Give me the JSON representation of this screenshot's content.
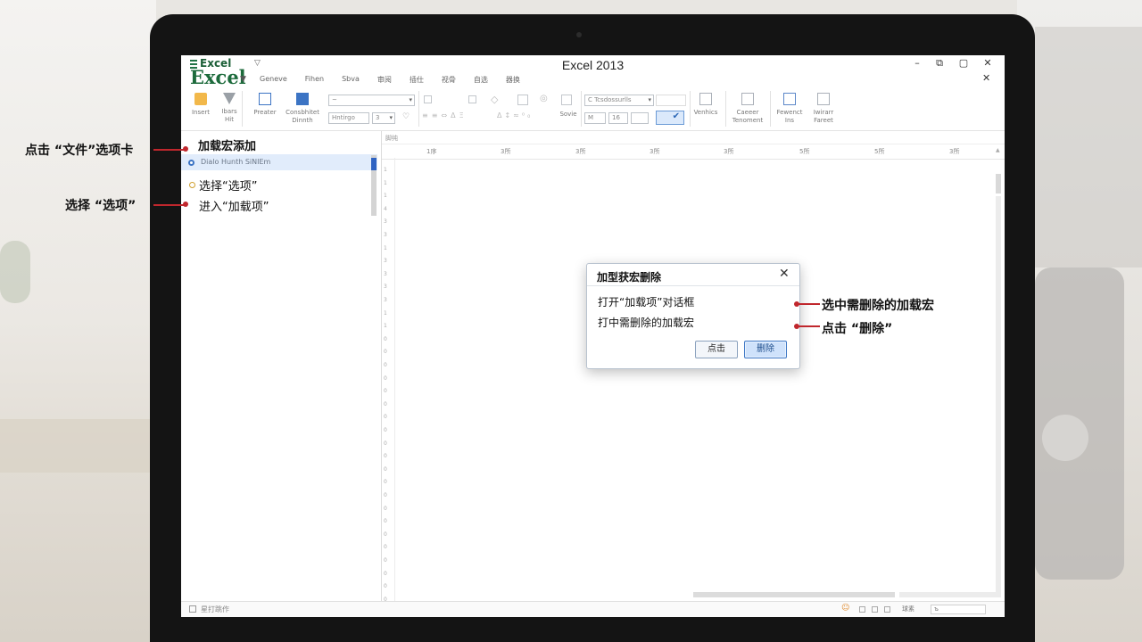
{
  "window": {
    "title": "Excel 2013",
    "logo_small": "Excel",
    "logo_big": "Excel",
    "menu": [
      "Geneve",
      "Fihen",
      "Sbva",
      "审阅",
      "插仕",
      "视骨",
      "自选",
      "器换"
    ],
    "controls": {
      "minimize": "–",
      "restore": "⧉",
      "maximize": "▢",
      "close": "✕",
      "close_doc": "✕"
    }
  },
  "ribbon": {
    "buttons": [
      {
        "label": "Insert"
      },
      {
        "label": "Ibars",
        "label2": "Hit"
      },
      {
        "label": "Preater"
      },
      {
        "label": "Consbhitet",
        "label2": "Dinnth"
      },
      {
        "label": "Venhics"
      },
      {
        "label": "Caeeer",
        "label2": "Tenoment"
      },
      {
        "label": "Fewenct",
        "label2": "Ins"
      },
      {
        "label": "Iwirarr",
        "label2": "Fareet"
      }
    ],
    "font_combo": "~",
    "size_combo": "Hntirgo",
    "size_num": "3",
    "style_combo": "C Tcsdossurlls",
    "num_box1": "M",
    "num_box2": "16",
    "small_groups": [
      "Sovie"
    ]
  },
  "pane": {
    "title": "加载宏添加",
    "selected_item": "Dialo Hunth SiNIEm",
    "items": [
      "选择“选项”",
      "进入“加载项”"
    ]
  },
  "grid": {
    "name_box": "脚纯",
    "columns": [
      "1序",
      "3所",
      "3所",
      "3所",
      "3所",
      "5所",
      "5所",
      "3所"
    ],
    "rows": [
      "1",
      "1",
      "1",
      "4",
      "3",
      "3",
      "1",
      "3",
      "3",
      "3",
      "3",
      "1",
      "1",
      "0",
      "0",
      "0",
      "0",
      "0",
      "0",
      "0",
      "0",
      "0",
      "0",
      "0",
      "0",
      "0",
      "0",
      "0",
      "0",
      "0",
      "0",
      "0",
      "0",
      "0",
      "0"
    ]
  },
  "dialog": {
    "title": "加型获宏删除",
    "line1": "打开“加载项”对话框",
    "line2": "打中需删除的加载宏",
    "ok_label": "点击",
    "delete_label": "删除",
    "close": "✕"
  },
  "status": {
    "text": "星打跳作",
    "zoom_label": "球素",
    "zoom_value": "ъ"
  },
  "annotations": {
    "left1": "点击 “文件”选项卡",
    "left2": "选择 “选项”",
    "right1": "选中需删除的加载宏",
    "right2": "点击 “删除”"
  },
  "colors": {
    "annotation_red": "#c0272d",
    "excel_green": "#1d6b3c",
    "selection_blue": "#e1ecfb",
    "accent_blue": "#3c74c4"
  }
}
